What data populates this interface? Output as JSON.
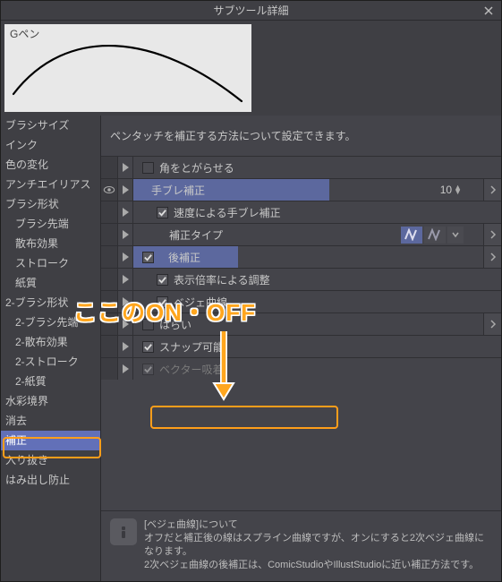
{
  "window": {
    "title": "サブツール詳細"
  },
  "preview": {
    "tool_name": "Gペン"
  },
  "sidebar": {
    "items": [
      {
        "label": "ブラシサイズ",
        "indent": false
      },
      {
        "label": "インク",
        "indent": false
      },
      {
        "label": "色の変化",
        "indent": false
      },
      {
        "label": "アンチエイリアス",
        "indent": false
      },
      {
        "label": "ブラシ形状",
        "indent": false
      },
      {
        "label": "ブラシ先端",
        "indent": true
      },
      {
        "label": "散布効果",
        "indent": true
      },
      {
        "label": "ストローク",
        "indent": true
      },
      {
        "label": "紙質",
        "indent": true
      },
      {
        "label": "2-ブラシ形状",
        "indent": false
      },
      {
        "label": "2-ブラシ先端",
        "indent": true
      },
      {
        "label": "2-散布効果",
        "indent": true
      },
      {
        "label": "2-ストローク",
        "indent": true
      },
      {
        "label": "2-紙質",
        "indent": true
      },
      {
        "label": "水彩境界",
        "indent": false
      },
      {
        "label": "消去",
        "indent": false
      },
      {
        "label": "補正",
        "indent": false,
        "selected": true
      },
      {
        "label": "入り抜き",
        "indent": false
      },
      {
        "label": "はみ出し防止",
        "indent": false
      }
    ]
  },
  "main": {
    "description": "ペンタッチを補正する方法について設定できます。",
    "rows": [
      {
        "checkbox": false,
        "checked": false,
        "label": "角をとがらせる",
        "chev": false
      },
      {
        "slider": true,
        "fill": 0.56,
        "label": "手ブレ補正",
        "value": "10",
        "chev": true,
        "eye": true
      },
      {
        "checkbox": true,
        "checked": true,
        "label": "速度による手ブレ補正",
        "chev": false,
        "indent": 1
      },
      {
        "type_icons": true,
        "label": "補正タイプ",
        "chev": true,
        "indent": 2
      },
      {
        "checkbox": true,
        "checked": true,
        "slider": true,
        "fill": 0.3,
        "label": "後補正",
        "chev": true
      },
      {
        "checkbox": true,
        "checked": true,
        "label": "表示倍率による調整",
        "chev": false,
        "indent": 1
      },
      {
        "checkbox": true,
        "checked": true,
        "label": "ベジェ曲線",
        "chev": false,
        "indent": 1
      },
      {
        "checkbox": false,
        "checked": false,
        "label": "はらい",
        "chev": true
      },
      {
        "checkbox": true,
        "checked": true,
        "label": "スナップ可能",
        "chev": false,
        "highlight": true
      },
      {
        "checkbox": true,
        "checked": true,
        "label": "ベクター吸着",
        "chev": false,
        "disabled": true
      }
    ],
    "info": {
      "title": "[ベジェ曲線]について",
      "body1": "オフだと補正後の線はスプライン曲線ですが、オンにすると2次ベジェ曲線になります。",
      "body2": "2次ベジェ曲線の後補正は、ComicStudioやIllustStudioに近い補正方法です。"
    }
  },
  "overlay": {
    "text": "ここのON・OFF"
  }
}
